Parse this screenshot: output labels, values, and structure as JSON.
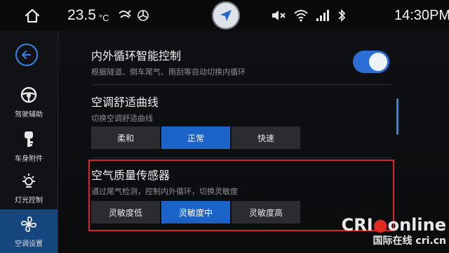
{
  "status": {
    "temperature": "23.5",
    "temp_unit": "°C",
    "time": "14:30",
    "ampm": "PM"
  },
  "sidebar": {
    "items": [
      {
        "label": "驾驶辅助",
        "icon": "steering-wheel-icon"
      },
      {
        "label": "车身附件",
        "icon": "key-icon"
      },
      {
        "label": "灯光控制",
        "icon": "light-icon"
      },
      {
        "label": "空调设置",
        "icon": "fan-icon"
      }
    ],
    "active_index": 3
  },
  "settings": {
    "recirculation": {
      "title": "内外循环智能控制",
      "desc": "根据隧道、倒车尾气、雨刮等自动切换内循环",
      "enabled": true
    },
    "comfort_curve": {
      "title": "空调舒适曲线",
      "desc": "切换空调舒适曲线",
      "options": [
        "柔和",
        "正常",
        "快速"
      ],
      "selected": "正常"
    },
    "air_quality": {
      "title": "空气质量传感器",
      "desc": "通过尾气检测，控制内外循环，切换灵敏度",
      "options": [
        "灵敏度低",
        "灵敏度中",
        "灵敏度高"
      ],
      "selected": "灵敏度中"
    }
  },
  "watermark": {
    "logo_main": "CRI",
    "logo_tail": "online",
    "sub": "国际在线 cri.cn"
  },
  "colors": {
    "accent": "#1c63c8",
    "highlight": "#d8262b"
  }
}
